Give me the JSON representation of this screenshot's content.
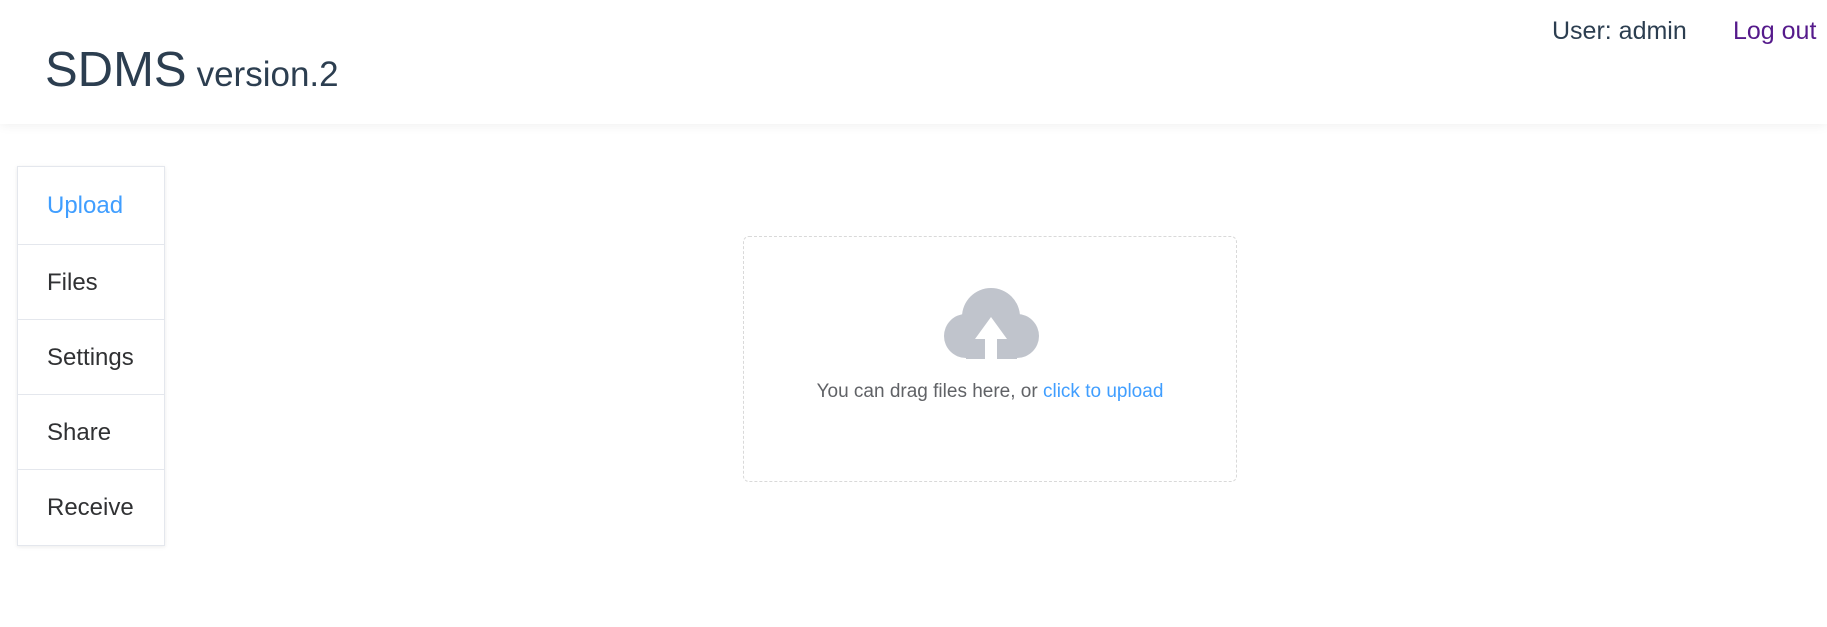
{
  "header": {
    "title": "SDMS",
    "version": "version.2",
    "user_label": "User: admin",
    "logout_label": "Log out"
  },
  "sidebar": {
    "items": [
      {
        "label": "Upload",
        "active": true
      },
      {
        "label": "Files"
      },
      {
        "label": "Settings"
      },
      {
        "label": "Share"
      },
      {
        "label": "Receive"
      }
    ]
  },
  "upload": {
    "icon": "cloud-upload-icon",
    "drag_text": "You can drag files here, or ",
    "click_text": "click to upload"
  },
  "colors": {
    "accent": "#409eff",
    "visited_link": "#551a8b",
    "icon_gray": "#c0c4cc",
    "text_dark": "#2c3e50"
  }
}
